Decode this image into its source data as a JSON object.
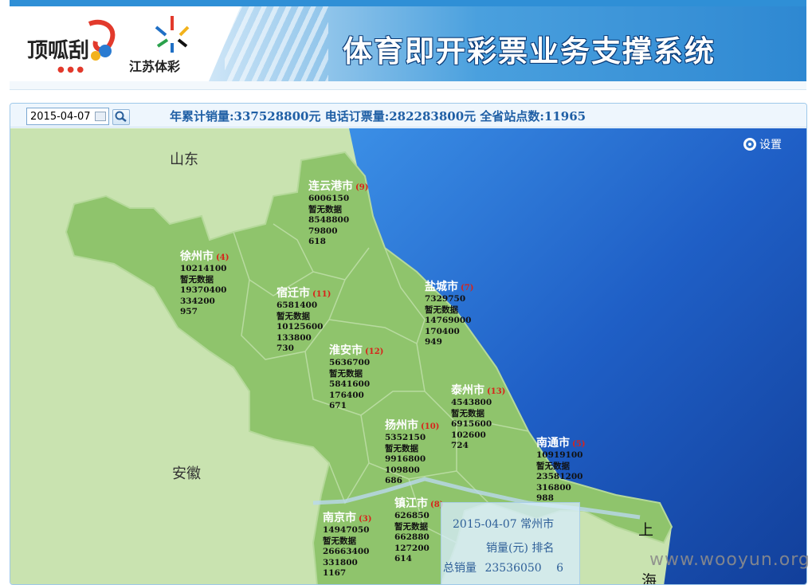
{
  "header": {
    "system_title": "体育即开彩票业务支撑系统",
    "brand_name": "江苏体彩",
    "logo_text": "顶呱刮"
  },
  "toolbar": {
    "date_value": "2015-04-07",
    "summary": "年累计销量:337528800元 电话订票量:282283800元 全省站点数:11965"
  },
  "map": {
    "settings_label": "设置",
    "provinces": {
      "shandong": "山东",
      "anhui": "安徽",
      "shanghai_1": "上",
      "shanghai_2": "海"
    },
    "cities": [
      {
        "name": "连云港市",
        "rank": "(9)",
        "values": [
          "6006150",
          "暂无数据",
          "8548800",
          "79800",
          "618"
        ]
      },
      {
        "name": "徐州市",
        "rank": "(4)",
        "values": [
          "10214100",
          "暂无数据",
          "19370400",
          "334200",
          "957"
        ]
      },
      {
        "name": "宿迁市",
        "rank": "(11)",
        "values": [
          "6581400",
          "暂无数据",
          "10125600",
          "133800",
          "730"
        ]
      },
      {
        "name": "盐城市",
        "rank": "(7)",
        "values": [
          "7329750",
          "暂无数据",
          "14769000",
          "170400",
          "949"
        ]
      },
      {
        "name": "淮安市",
        "rank": "(12)",
        "values": [
          "5636700",
          "暂无数据",
          "5841600",
          "176400",
          "671"
        ]
      },
      {
        "name": "泰州市",
        "rank": "(13)",
        "values": [
          "4543800",
          "暂无数据",
          "6915600",
          "102600",
          "724"
        ]
      },
      {
        "name": "扬州市",
        "rank": "(10)",
        "values": [
          "5352150",
          "暂无数据",
          "9916800",
          "109800",
          "686"
        ]
      },
      {
        "name": "南通市",
        "rank": "(5)",
        "values": [
          "10919100",
          "暂无数据",
          "23581200",
          "316800",
          "988"
        ]
      },
      {
        "name": "镇江市",
        "rank": "(8)",
        "values": [
          "626850",
          "暂无数据",
          "662880",
          "127200",
          "614"
        ]
      },
      {
        "name": "南京市",
        "rank": "(3)",
        "values": [
          "14947050",
          "暂无数据",
          "26663400",
          "331800",
          "1167"
        ]
      }
    ]
  },
  "tooltip": {
    "title": "2015-04-07 常州市",
    "head": "销量(元) 排名",
    "row_label": "总销量",
    "row_value": "23536050",
    "row_rank": "6"
  },
  "watermark": "www.wooyun.org"
}
